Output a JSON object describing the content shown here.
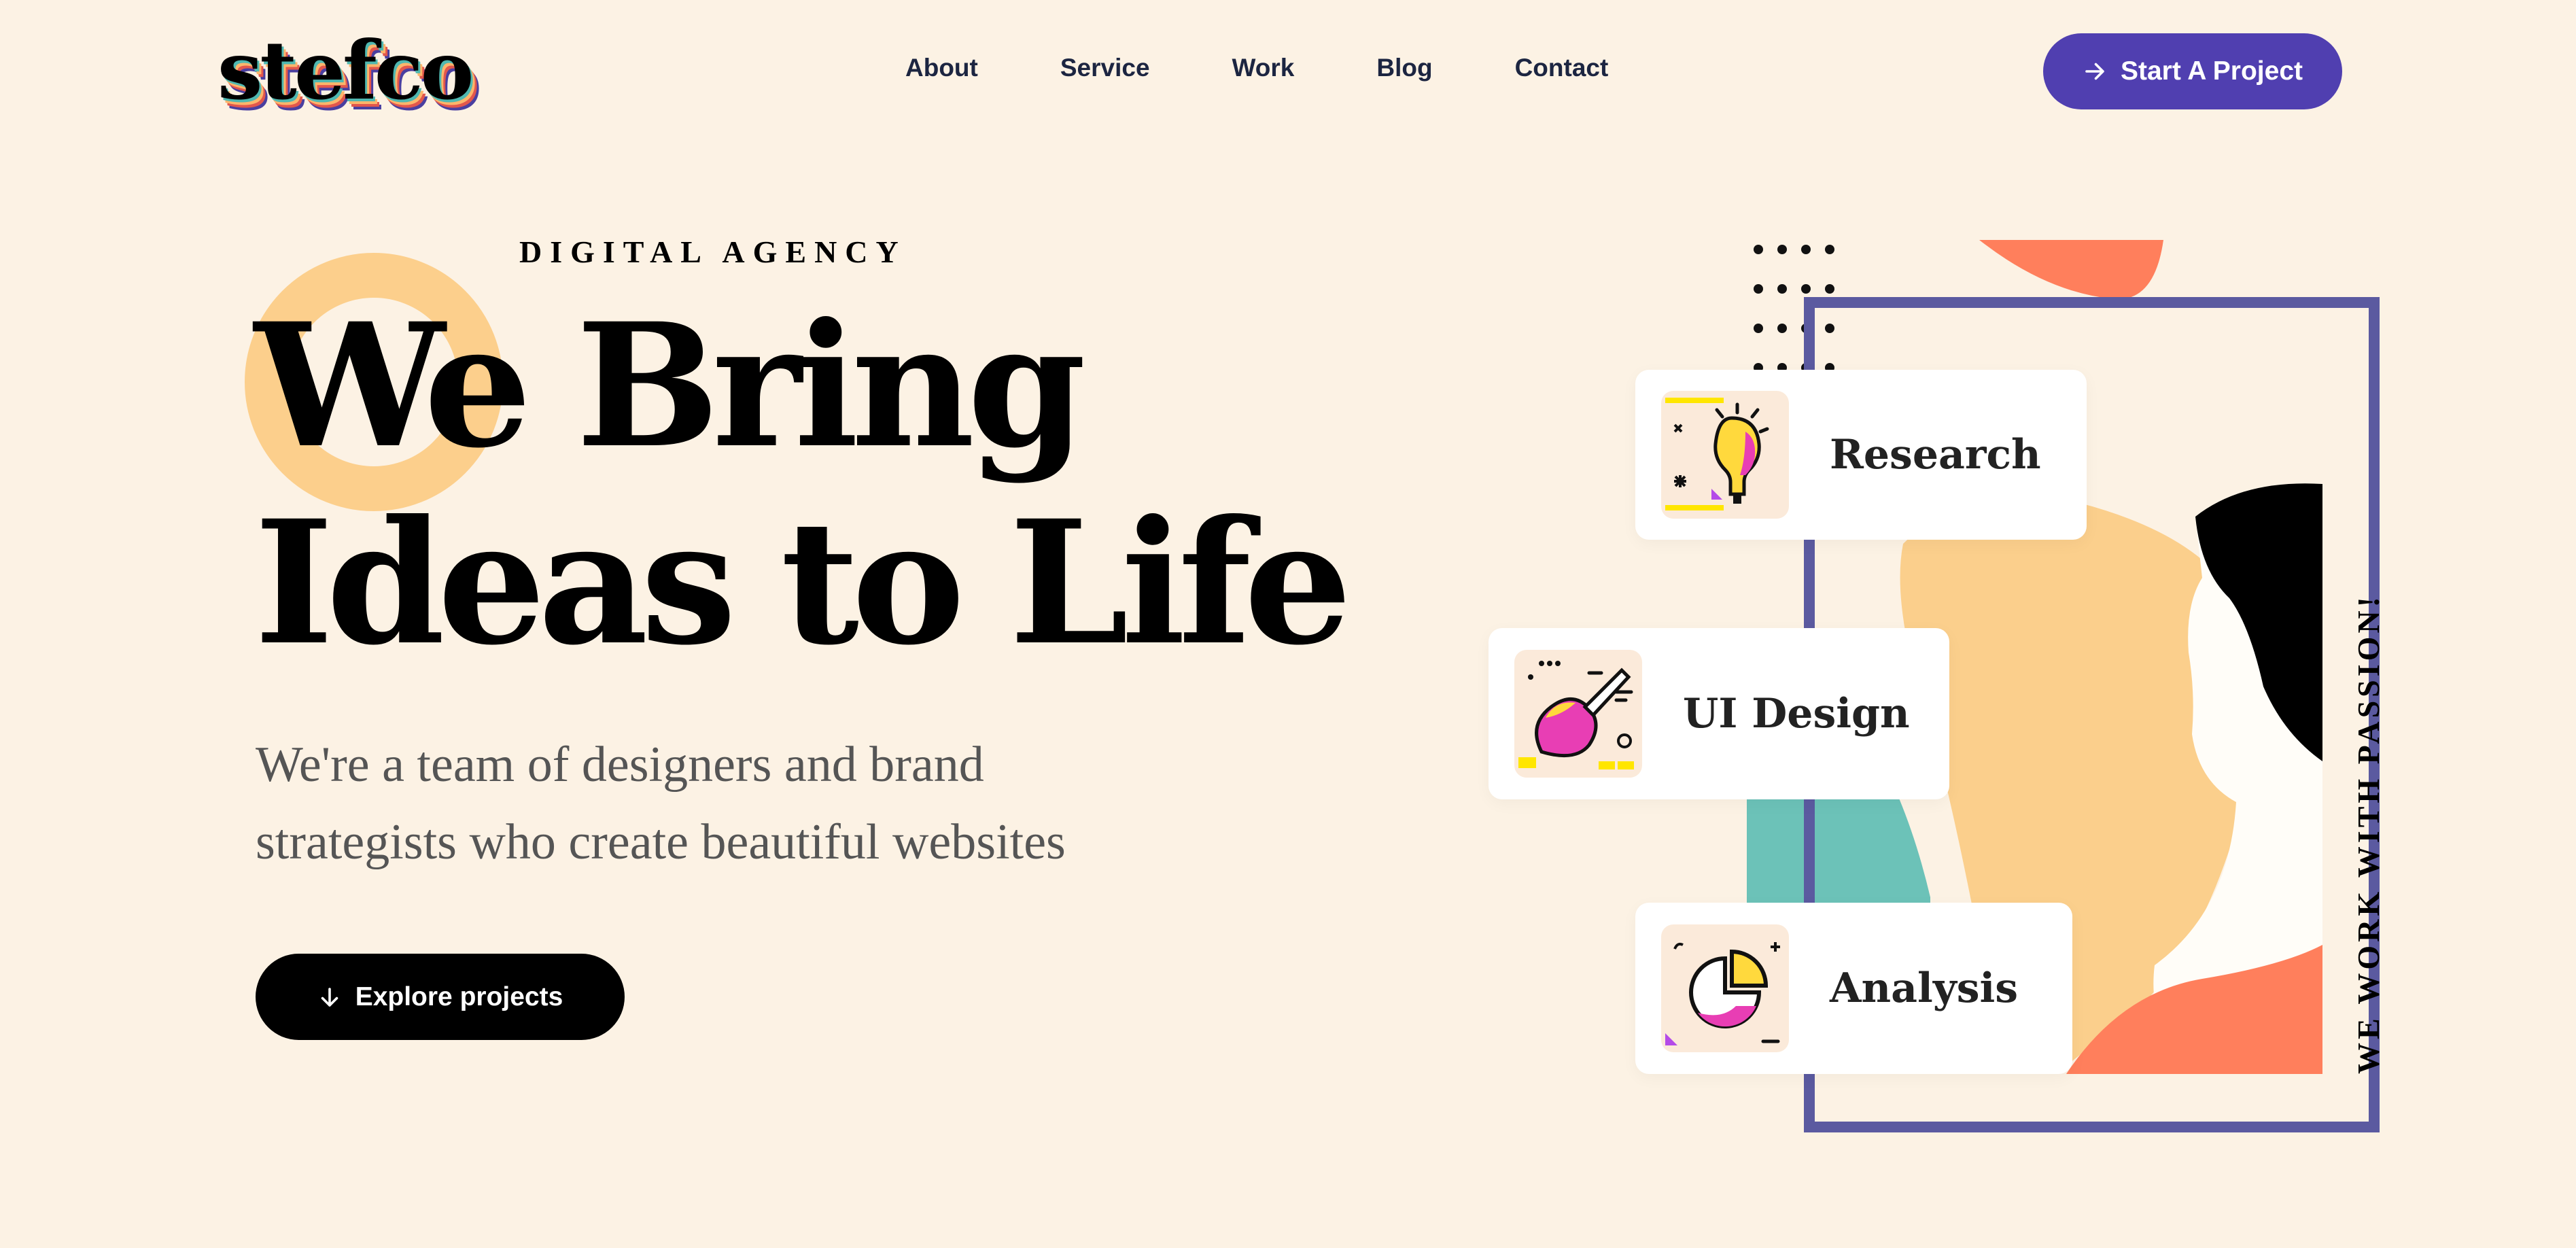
{
  "brand": {
    "logo_text": "stefco"
  },
  "nav": {
    "items": [
      {
        "label": "About"
      },
      {
        "label": "Service"
      },
      {
        "label": "Work"
      },
      {
        "label": "Blog"
      },
      {
        "label": "Contact"
      }
    ]
  },
  "header": {
    "cta_label": "Start A Project",
    "cta_icon": "arrow-right-icon",
    "cta_color": "#503FB0"
  },
  "hero": {
    "eyebrow": "DIGITAL AGENCY",
    "headline_line1": "We Bring",
    "headline_line2": "Ideas to Life",
    "subcopy": "We're a team of designers and brand strategists who create beautiful websites",
    "explore_label": "Explore projects",
    "explore_icon": "arrow-down-icon",
    "vertical_tag": "WE WORK WITH PASSION!"
  },
  "services": [
    {
      "label": "Research",
      "icon": "lightbulb-icon"
    },
    {
      "label": "UI Design",
      "icon": "paintbrush-icon"
    },
    {
      "label": "Analysis",
      "icon": "pie-chart-icon"
    }
  ],
  "colors": {
    "background": "#FCF2E4",
    "accent_purple": "#503FB0",
    "frame_purple": "#5B5AA0",
    "ring_orange": "#FCCF8C",
    "coral": "#FF7F5C",
    "teal": "#6CC2B8",
    "text_dark": "#1C2541"
  }
}
